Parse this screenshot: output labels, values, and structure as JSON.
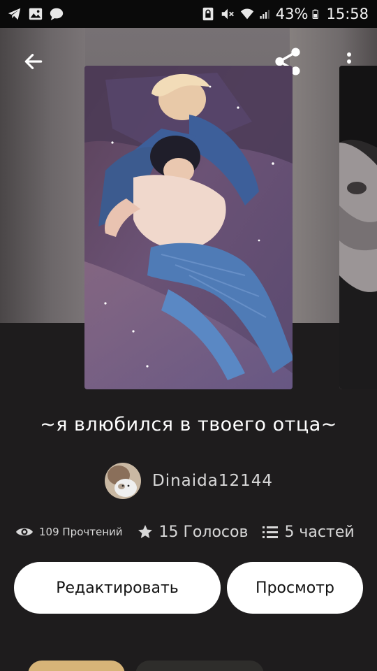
{
  "status_bar": {
    "icons_left": [
      "telegram-icon",
      "gallery-icon",
      "chat-icon"
    ],
    "icons_right": [
      "screen-lock-icon",
      "mute-icon",
      "wifi-icon",
      "signal-icon",
      "battery-icon"
    ],
    "battery": "43%",
    "time": "15:58"
  },
  "header": {
    "back_icon": "arrow-left-icon",
    "share_icon": "share-icon",
    "menu_icon": "more-vertical-icon"
  },
  "story": {
    "title": "~я влюбился в твоего отца~",
    "author": "Dinaida12144",
    "stats": {
      "reads": "109 Прочтений",
      "votes": "15 Голосов",
      "parts": "5 частей"
    }
  },
  "actions": {
    "edit_label": "Редактировать",
    "view_label": "Просмотр"
  },
  "colors": {
    "background": "#1e1c1d",
    "button_bg": "#ffffff",
    "chip_gold": "#d7b478"
  }
}
